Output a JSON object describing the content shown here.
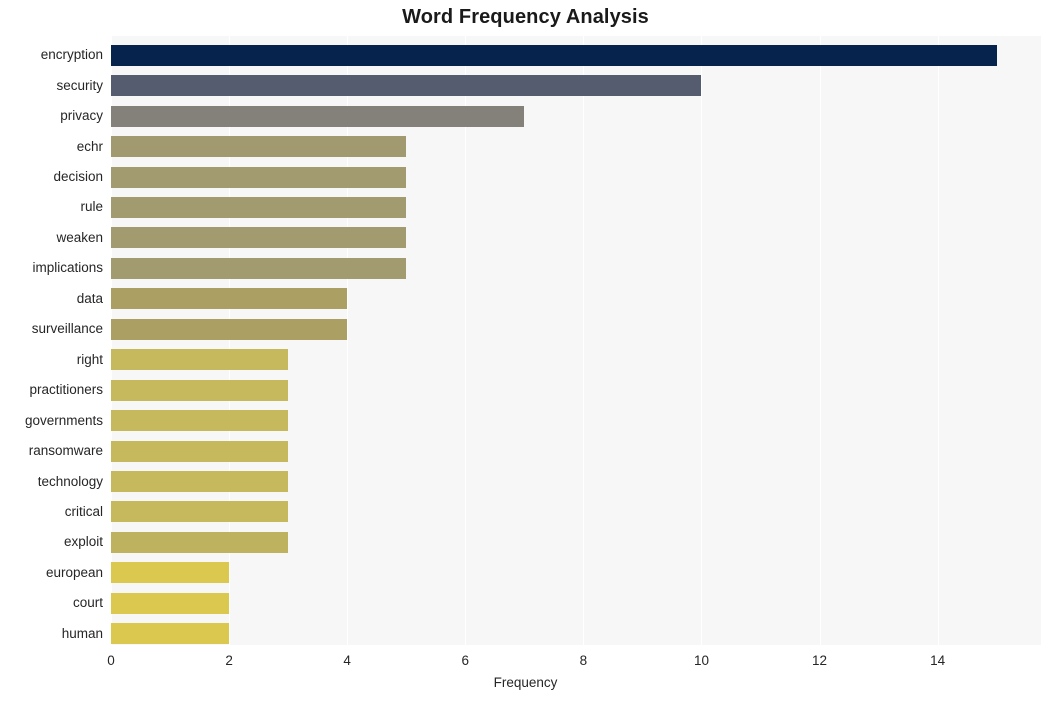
{
  "chart_data": {
    "type": "bar",
    "orientation": "horizontal",
    "title": "Word Frequency Analysis",
    "xlabel": "Frequency",
    "ylabel": "",
    "categories": [
      "encryption",
      "security",
      "privacy",
      "echr",
      "decision",
      "rule",
      "weaken",
      "implications",
      "data",
      "surveillance",
      "right",
      "practitioners",
      "governments",
      "ransomware",
      "technology",
      "critical",
      "exploit",
      "european",
      "court",
      "human"
    ],
    "values": [
      15,
      10,
      7,
      5,
      5,
      5,
      5,
      5,
      4,
      4,
      3,
      3,
      3,
      3,
      3,
      3,
      3,
      2,
      2,
      2
    ],
    "bar_colors": [
      "#06234d",
      "#565c70",
      "#84817a",
      "#a1996f",
      "#a39b70",
      "#a39b70",
      "#a39b70",
      "#a39b70",
      "#ab9f63",
      "#ab9f63",
      "#c6b85d",
      "#c6b85d",
      "#c6b85d",
      "#c6b85d",
      "#c6b85d",
      "#c6b85d",
      "#bfb25f",
      "#dbc94f",
      "#dbc94f",
      "#dbc94f"
    ],
    "xlim": [
      0,
      15.75
    ],
    "xticks": [
      0,
      2,
      4,
      6,
      8,
      10,
      12,
      14
    ],
    "xtick_labels": [
      "0",
      "2",
      "4",
      "6",
      "8",
      "10",
      "12",
      "14"
    ],
    "grid": true,
    "grid_axis": "x",
    "legend": null,
    "plot_background": "#f7f7f7",
    "figure_background": "#ffffff",
    "gridline_color": "#ffffff"
  }
}
